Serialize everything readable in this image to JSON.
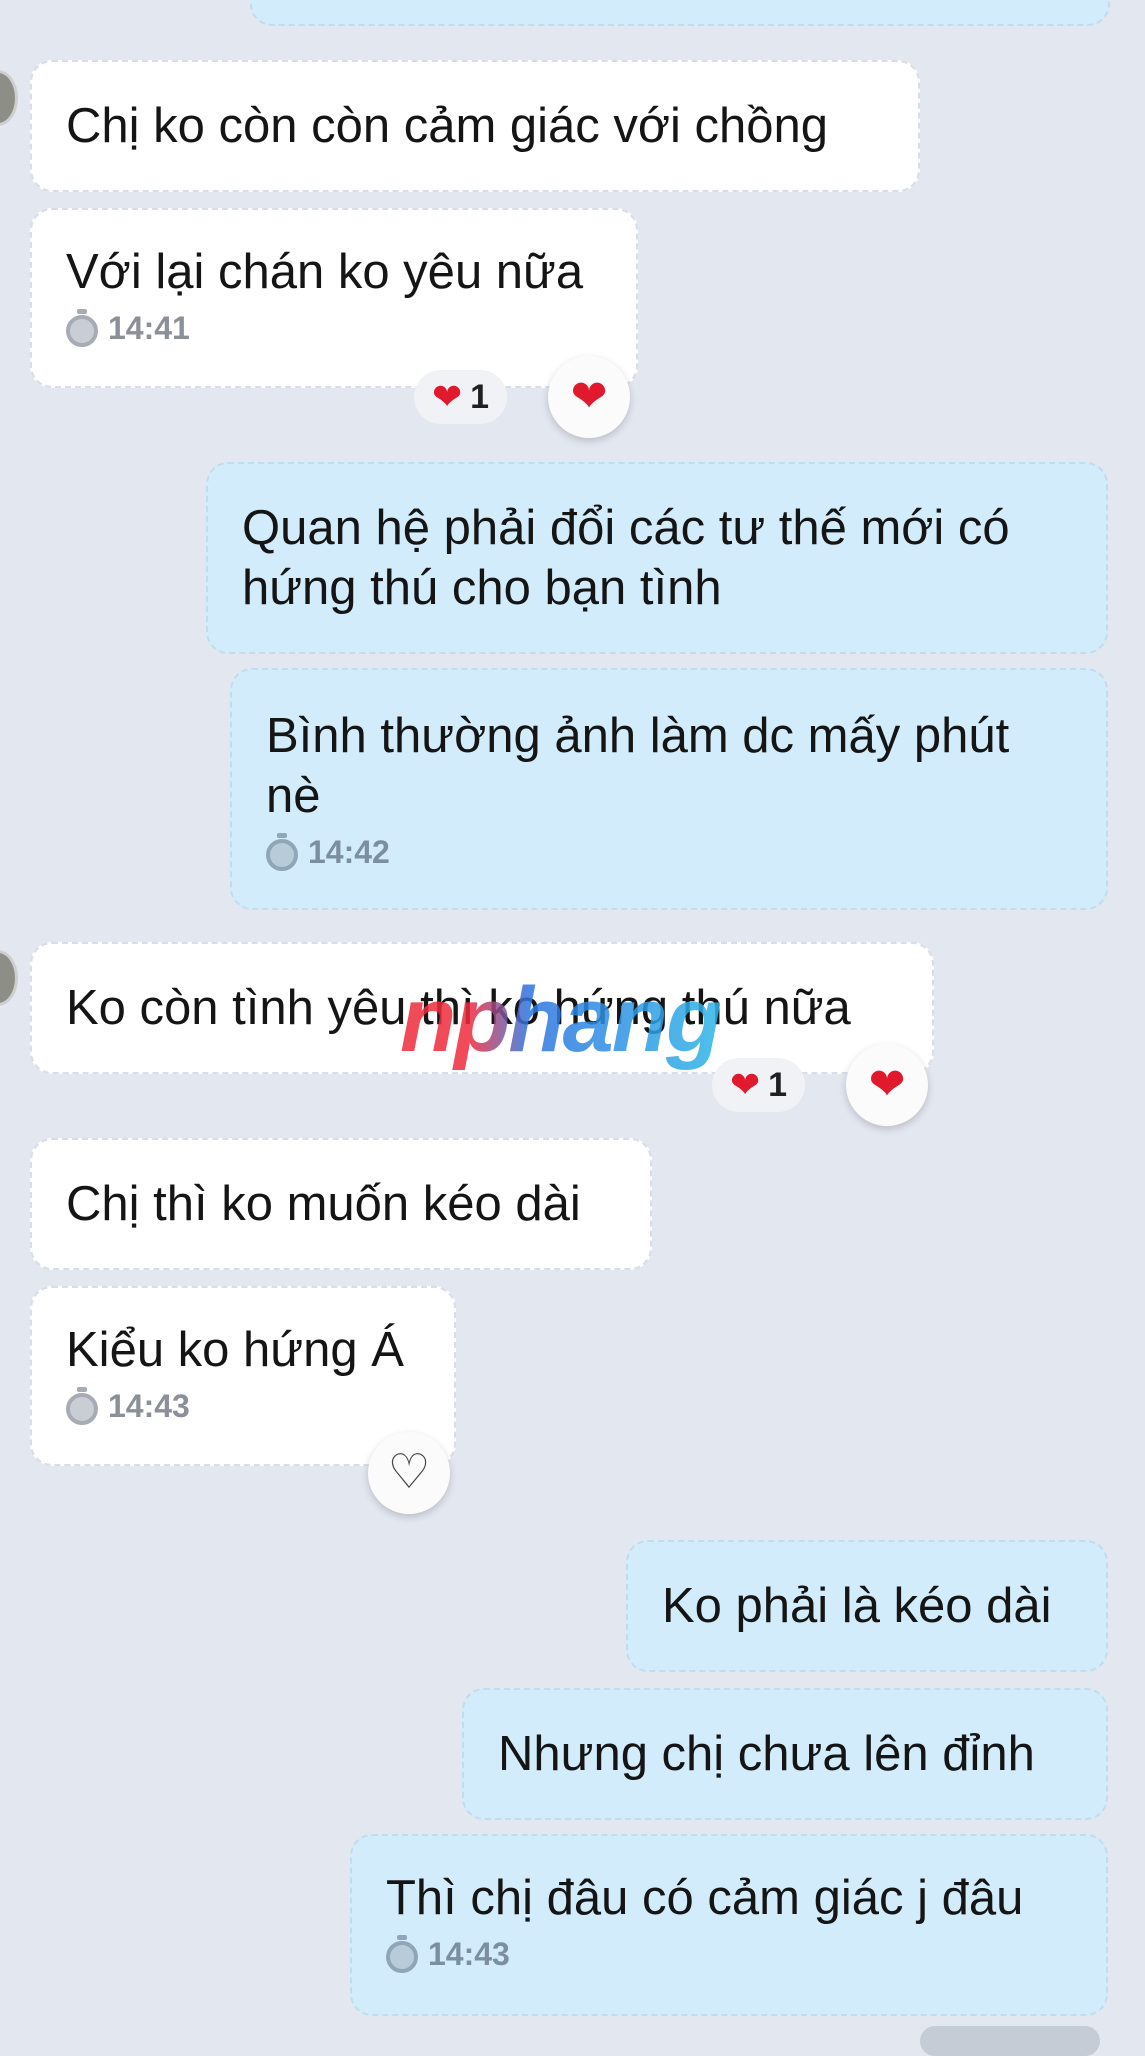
{
  "messages": [
    {
      "id": "m1",
      "side": "in",
      "text": "Chị ko còn còn cảm giác với chồng"
    },
    {
      "id": "m2",
      "side": "in",
      "text": "Với lại chán ko yêu nữa",
      "time": "14:41",
      "reaction": {
        "emoji": "❤",
        "count": "1"
      }
    },
    {
      "id": "m3",
      "side": "out",
      "text": "Quan hệ phải đổi các tư thế mới có hứng thú cho bạn tình"
    },
    {
      "id": "m4",
      "side": "out",
      "text": "Bình thường ảnh làm dc mấy phút nè",
      "time": "14:42"
    },
    {
      "id": "m5",
      "side": "in",
      "text": "Ko còn tình yêu thì ko hứng thú nữa",
      "reaction": {
        "emoji": "❤",
        "count": "1"
      }
    },
    {
      "id": "m6",
      "side": "in",
      "text": "Chị thì ko muốn kéo dài"
    },
    {
      "id": "m7",
      "side": "in",
      "text": "Kiểu ko hứng Á",
      "time": "14:43"
    },
    {
      "id": "m8",
      "side": "out",
      "text": "Ko phải là kéo dài"
    },
    {
      "id": "m9",
      "side": "out",
      "text": "Nhưng chị chưa lên đỉnh"
    },
    {
      "id": "m10",
      "side": "out",
      "text": "Thì chị đâu có cảm giác j đâu",
      "time": "14:43"
    }
  ],
  "watermark": "nphang",
  "colors": {
    "background": "#e3e7f0",
    "incoming": "#ffffff",
    "outgoing": "#d2ecfb",
    "heart": "#e0192d"
  },
  "icons": {
    "time": "clock-icon",
    "reaction": "heart-icon",
    "react_empty": "heart-outline-icon"
  }
}
